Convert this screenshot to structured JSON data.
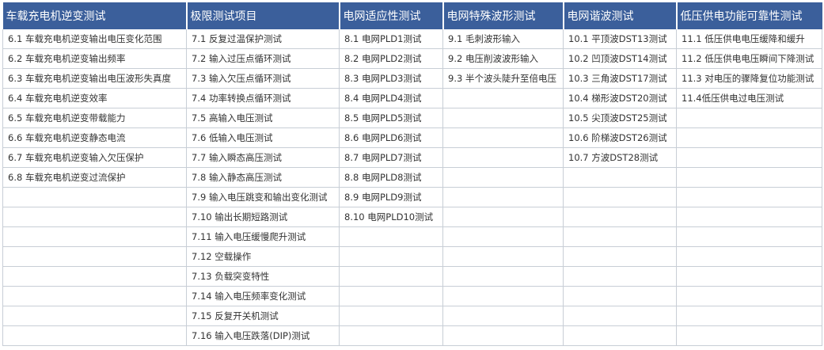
{
  "headers": [
    "车载充电机逆变测试",
    "极限测试项目",
    "电网适应性测试",
    "电网特殊波形测试",
    "电网谐波测试",
    "低压供电功能可靠性测试"
  ],
  "rows": [
    [
      "6.1 车载充电机逆变输出电压变化范围",
      "7.1 反复过温保护测试",
      "8.1 电网PLD1测试",
      "9.1 毛刺波形输入",
      "10.1 平顶波DST13测试",
      "11.1 低压供电电压缓降和缓升"
    ],
    [
      "6.2 车载充电机逆变输出频率",
      "7.2 输入过压点循环测试",
      "8.2 电网PLD2测试",
      "9.2 电压削波波形输入",
      "10.2 凹顶波DST14测试",
      "11.2 低压供电电压瞬间下降测试"
    ],
    [
      "6.3 车载充电机逆变输出电压波形失真度",
      "7.3 输入欠压点循环测试",
      "8.3 电网PLD3测试",
      "9.3 半个波头陡升至倍电压",
      "10.3 三角波DST17测试",
      "11.3 对电压的骤降复位功能测试"
    ],
    [
      "6.4 车载充电机逆变效率",
      "7.4 功率转换点循环测试",
      "8.4 电网PLD4测试",
      "",
      "10.4 梯形波DST20测试",
      "11.4低压供电过电压测试"
    ],
    [
      "6.5 车载充电机逆变带载能力",
      "7.5 高输入电压测试",
      "8.5 电网PLD5测试",
      "",
      "10.5 尖顶波DST25测试",
      ""
    ],
    [
      "6.6 车载充电机逆变静态电流",
      "7.6 低输入电压测试",
      "8.6 电网PLD6测试",
      "",
      "10.6 阶梯波DST26测试",
      ""
    ],
    [
      "6.7 车载充电机逆变输入欠压保护",
      "7.7 输入瞬态高压测试",
      "8.7 电网PLD7测试",
      "",
      "10.7 方波DST28测试",
      ""
    ],
    [
      "6.8 车载充电机逆变过流保护",
      "7.8 输入静态高压测试",
      "8.8 电网PLD8测试",
      "",
      "",
      ""
    ],
    [
      "",
      "7.9 输入电压跳变和输出变化测试",
      "8.9 电网PLD9测试",
      "",
      "",
      ""
    ],
    [
      "",
      "7.10 输出长期短路测试",
      "8.10 电网PLD10测试",
      "",
      "",
      ""
    ],
    [
      "",
      "7.11 输入电压缓慢爬升测试",
      "",
      "",
      "",
      ""
    ],
    [
      "",
      "7.12 空载操作",
      "",
      "",
      "",
      ""
    ],
    [
      "",
      "7.13 负载突变特性",
      "",
      "",
      "",
      ""
    ],
    [
      "",
      "7.14 输入电压频率变化测试",
      "",
      "",
      "",
      ""
    ],
    [
      "",
      "7.15 反复开关机测试",
      "",
      "",
      "",
      ""
    ],
    [
      "",
      "7.16 输入电压跌落(DIP)测试",
      "",
      "",
      "",
      ""
    ]
  ]
}
